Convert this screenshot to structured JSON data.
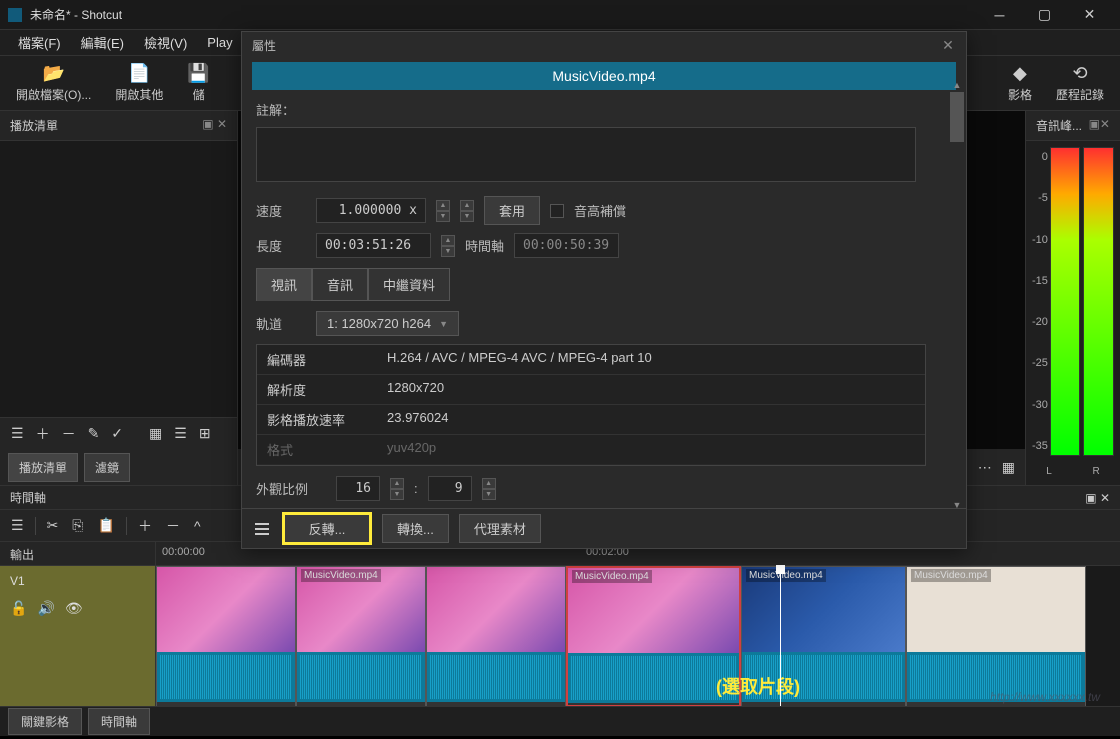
{
  "window": {
    "title": "未命名* - Shotcut"
  },
  "menu": {
    "file": "檔案(F)",
    "edit": "編輯(E)",
    "view": "檢視(V)",
    "play": "Play"
  },
  "toolbar": {
    "open": "開啟檔案(O)...",
    "openOther": "開啟其他",
    "save": "儲",
    "keyframes": "影格",
    "history": "歷程記錄"
  },
  "panels": {
    "playlist": "播放清單",
    "playlistTab": "播放清單",
    "filters": "濾鏡",
    "timeline": "時間軸",
    "audioPeak": "音訊峰..."
  },
  "audioLevels": [
    "0",
    "-5",
    "-10",
    "-15",
    "-20",
    "-25",
    "-30",
    "-35"
  ],
  "audioLR": {
    "L": "L",
    "R": "R"
  },
  "dialog": {
    "title": "屬性",
    "banner": "MusicVideo.mp4",
    "commentLabel": "註解：",
    "speedLabel": "速度",
    "speedValue": "1.000000 x",
    "applyBtn": "套用",
    "pitchComp": "音高補償",
    "durationLabel": "長度",
    "durationValue": "00:03:51:26",
    "timelineLabel": "時間軸",
    "timelineValue": "00:00:50:39",
    "tabs": {
      "video": "視訊",
      "audio": "音訊",
      "meta": "中繼資料"
    },
    "trackLabel": "軌道",
    "trackSelect": "1: 1280x720 h264",
    "props": {
      "codec": {
        "k": "編碼器",
        "v": "H.264 / AVC / MPEG-4 AVC / MPEG-4 part 10"
      },
      "resolution": {
        "k": "解析度",
        "v": "1280x720"
      },
      "framerate": {
        "k": "影格播放速率",
        "v": "23.976024"
      },
      "format": {
        "k": "格式",
        "v": "yuv420p"
      }
    },
    "aspectLabel": "外觀比例",
    "aspectW": "16",
    "aspectSep": ":",
    "aspectH": "9",
    "reverseBtn": "反轉...",
    "convertBtn": "轉換...",
    "proxyBtn": "代理素材"
  },
  "timeline": {
    "output": "輸出",
    "track": "V1",
    "ruler": {
      "t0": "00:00:00",
      "t2": "00:02:00"
    },
    "clipLabel": "MusicVideo.mp4",
    "annotation": "(選取片段)"
  },
  "bottomTabs": {
    "keyframes": "關鍵影格",
    "timeline": "時間軸"
  },
  "watermark": "http://www.xxxxxx.tw"
}
